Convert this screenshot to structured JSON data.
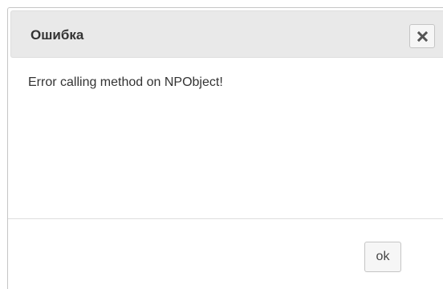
{
  "dialog": {
    "title": "Ошибка",
    "close_icon": "close-icon",
    "message": "Error calling method on NPObject!",
    "ok_label": "ok"
  },
  "colors": {
    "titlebar_bg": "#e9e9e9",
    "button_bg": "#f6f6f6",
    "border": "#c5c5c5",
    "text": "#333333"
  }
}
